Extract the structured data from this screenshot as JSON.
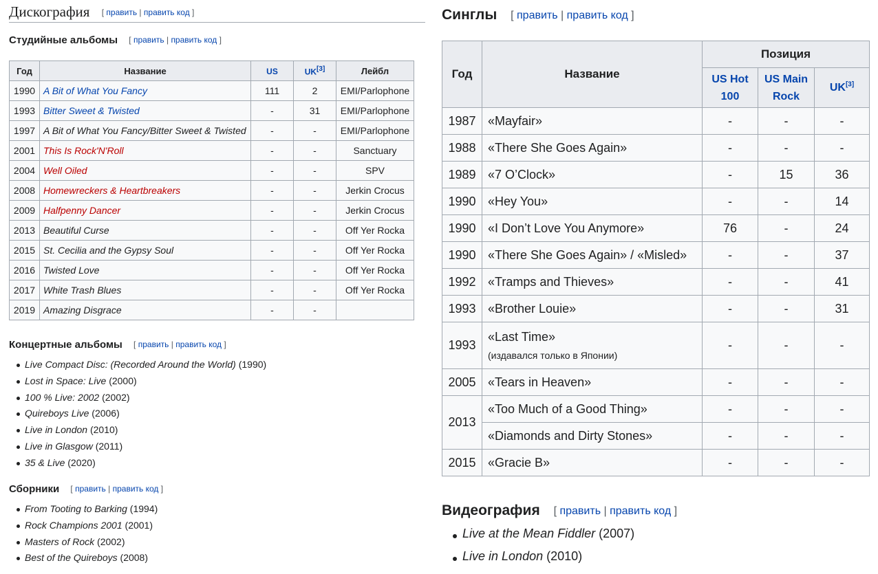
{
  "edit": {
    "open": "[",
    "close": "]",
    "sep": "|",
    "edit": "править",
    "edit_code": "править код"
  },
  "discography": {
    "title": "Дискография",
    "studio": {
      "title": "Студийные альбомы",
      "headers": {
        "year": "Год",
        "title": "Название",
        "us": "US",
        "uk": "UK",
        "uk_ref": "[3]",
        "label": "Лейбл"
      },
      "rows": [
        {
          "year": "1990",
          "title": "A Bit of What You Fancy",
          "us": "111",
          "uk": "2",
          "label": "EMI/Parlophone"
        },
        {
          "year": "1993",
          "title": "Bitter Sweet & Twisted",
          "us": "-",
          "uk": "31",
          "label": "EMI/Parlophone"
        },
        {
          "year": "1997",
          "title": "A Bit of What You Fancy/Bitter Sweet & Twisted",
          "us": "-",
          "uk": "-",
          "label": "EMI/Parlophone"
        },
        {
          "year": "2001",
          "title": "This Is Rock'N'Roll",
          "us": "-",
          "uk": "-",
          "label": "Sanctuary"
        },
        {
          "year": "2004",
          "title": "Well Oiled",
          "us": "-",
          "uk": "-",
          "label": "SPV"
        },
        {
          "year": "2008",
          "title": "Homewreckers & Heartbreakers",
          "us": "-",
          "uk": "-",
          "label": "Jerkin Crocus"
        },
        {
          "year": "2009",
          "title": "Halfpenny Dancer",
          "us": "-",
          "uk": "-",
          "label": "Jerkin Crocus"
        },
        {
          "year": "2013",
          "title": "Beautiful Curse",
          "us": "-",
          "uk": "-",
          "label": "Off Yer Rocka"
        },
        {
          "year": "2015",
          "title": "St. Cecilia and the Gypsy Soul",
          "us": "-",
          "uk": "-",
          "label": "Off Yer Rocka"
        },
        {
          "year": "2016",
          "title": "Twisted Love",
          "us": "-",
          "uk": "-",
          "label": "Off Yer Rocka"
        },
        {
          "year": "2017",
          "title": "White Trash Blues",
          "us": "-",
          "uk": "-",
          "label": "Off Yer Rocka"
        },
        {
          "year": "2019",
          "title": "Amazing Disgrace",
          "us": "-",
          "uk": "-",
          "label": ""
        }
      ],
      "row_colors": [
        "#0645ad",
        "#0645ad",
        "#202122",
        "#ba0000",
        "#ba0000",
        "#ba0000",
        "#ba0000",
        "#202122",
        "#202122",
        "#202122",
        "#202122",
        "#202122"
      ]
    },
    "live": {
      "title": "Концертные альбомы",
      "items": [
        {
          "title": "Live Compact Disc: (Recorded Around the World)",
          "year": "(1990)"
        },
        {
          "title": "Lost in Space: Live",
          "year": "(2000)"
        },
        {
          "title": "100 % Live: 2002",
          "year": "(2002)"
        },
        {
          "title": "Quireboys Live",
          "year": "(2006)"
        },
        {
          "title": "Live in London",
          "year": "(2010)"
        },
        {
          "title": "Live in Glasgow",
          "year": "(2011)"
        },
        {
          "title": "35 & Live",
          "year": "(2020)"
        }
      ]
    },
    "compilations": {
      "title": "Сборники",
      "items": [
        {
          "title": "From Tooting to Barking",
          "year": "(1994)"
        },
        {
          "title": "Rock Champions 2001",
          "year": "(2001)"
        },
        {
          "title": "Masters of Rock",
          "year": "(2002)"
        },
        {
          "title": "Best of the Quireboys",
          "year": "(2008)"
        }
      ]
    }
  },
  "singles": {
    "title": "Синглы",
    "headers": {
      "year": "Год",
      "title": "Название",
      "position": "Позиция",
      "us_hot_1": "US Hot",
      "us_hot_2": "100",
      "us_main_1": "US Main",
      "us_main_2": "Rock",
      "uk": "UK",
      "uk_ref": "[3]"
    },
    "rows": [
      {
        "year": "1987",
        "title": "«Mayfair»",
        "us_hot": "-",
        "us_main": "-",
        "uk": "-"
      },
      {
        "year": "1988",
        "title": "«There She Goes Again»",
        "us_hot": "-",
        "us_main": "-",
        "uk": "-"
      },
      {
        "year": "1989",
        "title": "«7 O’Clock»",
        "us_hot": "-",
        "us_main": "15",
        "uk": "36"
      },
      {
        "year": "1990",
        "title": "«Hey You»",
        "us_hot": "-",
        "us_main": "-",
        "uk": "14"
      },
      {
        "year": "1990",
        "title": "«I Don’t Love You Anymore»",
        "us_hot": "76",
        "us_main": "-",
        "uk": "24"
      },
      {
        "year": "1990",
        "title": "«There She Goes Again» / «Misled»",
        "us_hot": "-",
        "us_main": "-",
        "uk": "37"
      },
      {
        "year": "1992",
        "title": "«Tramps and Thieves»",
        "us_hot": "-",
        "us_main": "-",
        "uk": "41"
      },
      {
        "year": "1993",
        "title": "«Brother Louie»",
        "us_hot": "-",
        "us_main": "-",
        "uk": "31"
      },
      {
        "year": "1993",
        "title": "«Last Time»",
        "note": "(издавался только в Японии)",
        "us_hot": "-",
        "us_main": "-",
        "uk": "-"
      },
      {
        "year": "2005",
        "title": "«Tears in Heaven»",
        "us_hot": "-",
        "us_main": "-",
        "uk": "-"
      },
      {
        "year": "2013",
        "title": "«Too Much of a Good Thing»",
        "us_hot": "-",
        "us_main": "-",
        "uk": "-"
      },
      {
        "year": "",
        "title": "«Diamonds and Dirty Stones»",
        "us_hot": "-",
        "us_main": "-",
        "uk": "-"
      },
      {
        "year": "2015",
        "title": "«Gracie B»",
        "us_hot": "-",
        "us_main": "-",
        "uk": "-"
      }
    ]
  },
  "videography": {
    "title": "Видеография",
    "items": [
      {
        "title": "Live at the Mean Fiddler",
        "year": "(2007)"
      },
      {
        "title": "Live in London",
        "year": "(2010)"
      }
    ]
  }
}
